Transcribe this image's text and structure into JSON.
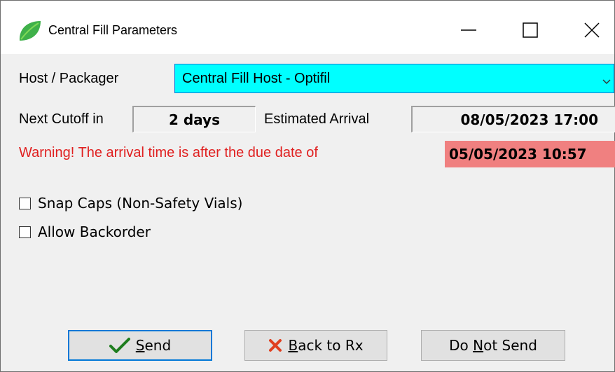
{
  "window": {
    "title": "Central Fill Parameters",
    "icon": "leaf-icon"
  },
  "host": {
    "label": "Host / Packager",
    "selected": "Central Fill Host - Optifil"
  },
  "cutoff": {
    "label": "Next Cutoff in",
    "value": "2 days"
  },
  "arrival": {
    "label": "Estimated Arrival",
    "value": "08/05/2023 17:00"
  },
  "warning": {
    "text": "Warning! The arrival time is after the due date of",
    "due_date": "05/05/2023 10:57"
  },
  "options": {
    "snap_caps": {
      "label": "Snap Caps (Non-Safety Vials)",
      "checked": false
    },
    "allow_backorder": {
      "label": "Allow Backorder",
      "checked": false
    }
  },
  "buttons": {
    "send": {
      "label_ul": "S",
      "label_rest": "end",
      "icon": "checkmark-icon"
    },
    "back": {
      "label_ul": "B",
      "label_rest": "ack to Rx",
      "icon": "x-icon"
    },
    "do_not_send": {
      "label_pre": "Do ",
      "label_ul": "N",
      "label_rest": "ot Send"
    }
  },
  "colors": {
    "host_select_bg": "#00ffff",
    "warning_text": "#e02020",
    "due_date_bg": "#f08080",
    "accent": "#0078d7"
  }
}
